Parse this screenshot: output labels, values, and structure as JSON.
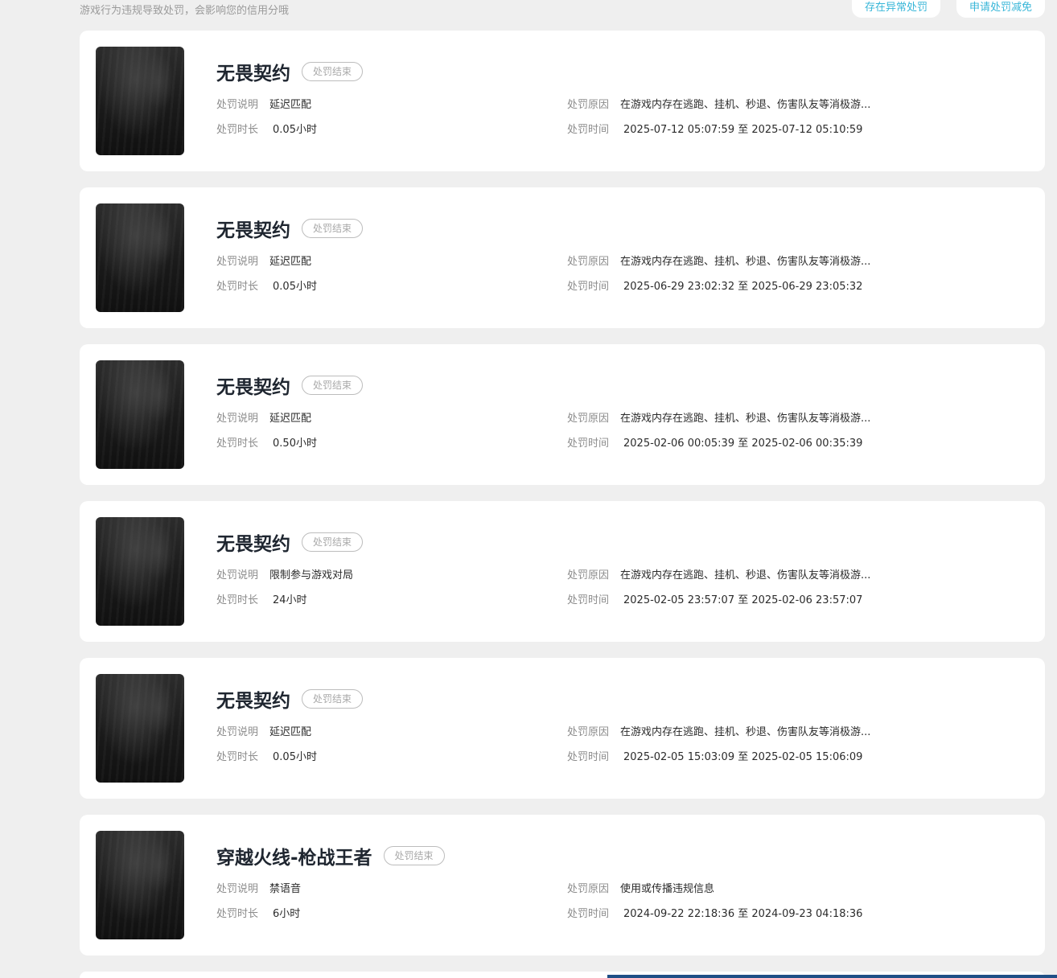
{
  "header": {
    "notice": "游戏行为违规导致处罚，会影响您的信用分哦",
    "abnormal_button": "存在异常处罚",
    "reduce_button": "申请处罚减免"
  },
  "labels": {
    "desc": "处罚说明",
    "duration": "处罚时长",
    "reason": "处罚原因",
    "time": "处罚时间"
  },
  "records": [
    {
      "game": "无畏契约",
      "status": "处罚结束",
      "desc": "延迟匹配",
      "duration": "0.05小时",
      "reason": "在游戏内存在逃跑、挂机、秒退、伤害队友等消极游...",
      "time": "2025-07-12 05:07:59 至 2025-07-12 05:10:59"
    },
    {
      "game": "无畏契约",
      "status": "处罚结束",
      "desc": "延迟匹配",
      "duration": "0.05小时",
      "reason": "在游戏内存在逃跑、挂机、秒退、伤害队友等消极游...",
      "time": "2025-06-29 23:02:32 至 2025-06-29 23:05:32"
    },
    {
      "game": "无畏契约",
      "status": "处罚结束",
      "desc": "延迟匹配",
      "duration": "0.50小时",
      "reason": "在游戏内存在逃跑、挂机、秒退、伤害队友等消极游...",
      "time": "2025-02-06 00:05:39 至 2025-02-06 00:35:39"
    },
    {
      "game": "无畏契约",
      "status": "处罚结束",
      "desc": "限制参与游戏对局",
      "duration": "24小时",
      "reason": "在游戏内存在逃跑、挂机、秒退、伤害队友等消极游...",
      "time": "2025-02-05 23:57:07 至 2025-02-06 23:57:07"
    },
    {
      "game": "无畏契约",
      "status": "处罚结束",
      "desc": "延迟匹配",
      "duration": "0.05小时",
      "reason": "在游戏内存在逃跑、挂机、秒退、伤害队友等消极游...",
      "time": "2025-02-05 15:03:09 至 2025-02-05 15:06:09"
    },
    {
      "game": "穿越火线-枪战王者",
      "status": "处罚结束",
      "desc": "禁语音",
      "duration": "6小时",
      "reason": "使用或传播违规信息",
      "time": "2024-09-22 22:18:36 至 2024-09-23 04:18:36"
    }
  ]
}
